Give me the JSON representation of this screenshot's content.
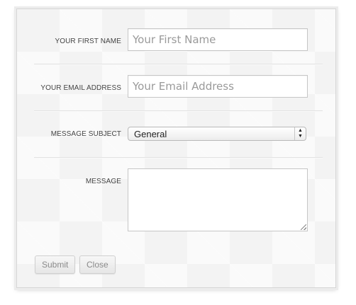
{
  "form": {
    "first_name": {
      "label": "YOUR FIRST NAME",
      "placeholder": "Your First Name",
      "value": ""
    },
    "email": {
      "label": "YOUR EMAIL ADDRESS",
      "placeholder": "Your Email Address",
      "value": ""
    },
    "subject": {
      "label": "MESSAGE SUBJECT",
      "selected": "General",
      "arrow_up": "▲",
      "arrow_down": "▼"
    },
    "message": {
      "label": "MESSAGE",
      "value": ""
    }
  },
  "buttons": {
    "submit_label": "Submit",
    "close_label": "Close"
  },
  "colors": {
    "panel_background": "#f3f3f3",
    "button_text": "#8a8a8a",
    "placeholder_text": "#9a9a9a"
  }
}
